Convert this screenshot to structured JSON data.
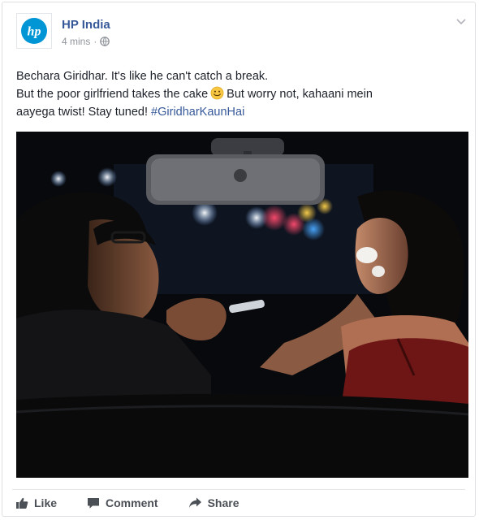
{
  "post": {
    "page_name": "HP India",
    "timestamp": "4 mins",
    "separator": "·",
    "privacy_icon": "globe-icon",
    "logo_text": "hp",
    "text_line1": "Bechara Giridhar. It's like he can't catch a break.",
    "text_line2_before": "But the poor girlfriend takes the cake",
    "text_line2_after": "But worry not, kahaani mein",
    "text_line3": "aayega twist! Stay tuned!",
    "hashtag": "#GiridharKaunHai",
    "emoji": "smile-emoji"
  },
  "actions": {
    "like_label": "Like",
    "comment_label": "Comment",
    "share_label": "Share"
  },
  "colors": {
    "link": "#365899",
    "hp_blue": "#0096d6",
    "meta": "#90949c",
    "action": "#4b4f56"
  }
}
